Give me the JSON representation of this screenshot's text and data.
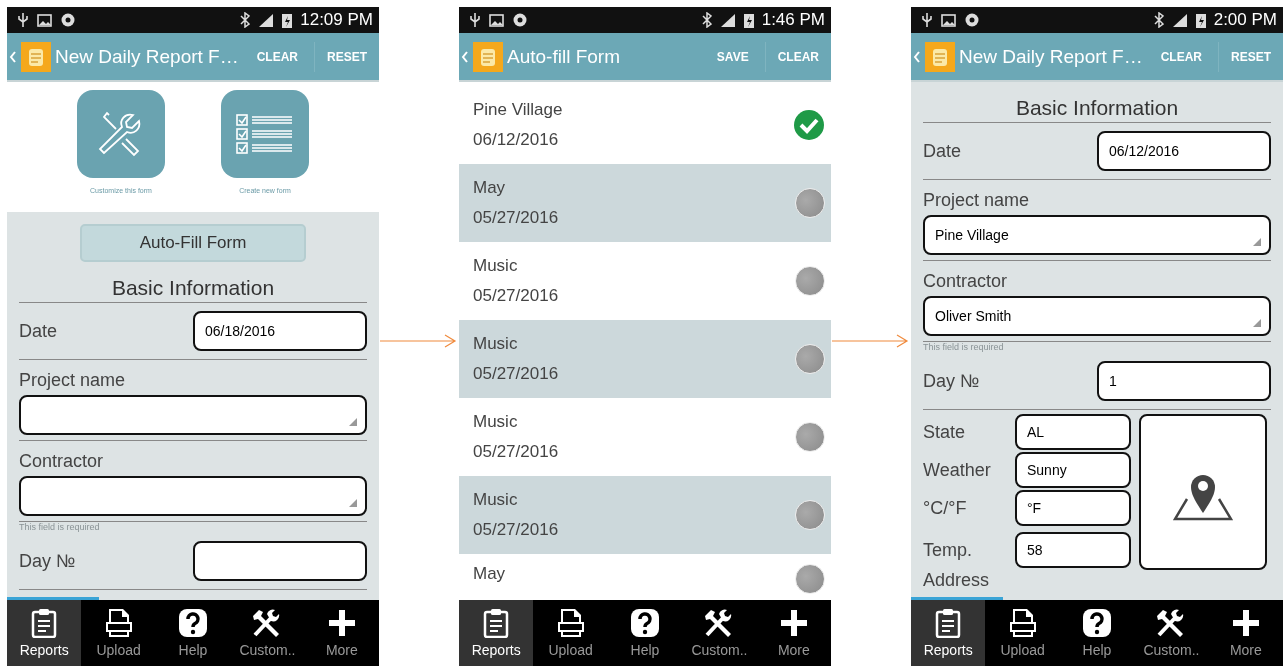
{
  "screens": [
    {
      "kind": "form",
      "status_bar": {
        "time": "12:09 PM"
      },
      "app_bar": {
        "title": "New Daily Report F…",
        "actions": [
          "CLEAR",
          "RESET"
        ]
      },
      "shortcuts": [
        {
          "kind": "tools",
          "label": "Customize this form"
        },
        {
          "kind": "checklist",
          "label": "Create new form"
        }
      ],
      "autofill_button": "Auto-Fill Form",
      "section_title": "Basic Information",
      "fields": [
        {
          "kind": "inline",
          "label": "Date",
          "value": "06/18/2016"
        },
        {
          "kind": "dropdown",
          "label": "Project name"
        },
        {
          "kind": "dropdown",
          "label": "Contractor",
          "error": "This field is required"
        },
        {
          "kind": "inline",
          "label": "Day №"
        }
      ],
      "nav": [
        {
          "label": "Reports",
          "selected": true
        },
        {
          "label": "Upload",
          "selected": false
        },
        {
          "label": "Help",
          "selected": false
        },
        {
          "label": "Custom..",
          "selected": false
        },
        {
          "label": "More",
          "selected": false
        }
      ]
    },
    {
      "kind": "list",
      "status_bar": {
        "time": "1:46 PM"
      },
      "app_bar": {
        "title": "Auto-fill Form",
        "actions": [
          "SAVE",
          "CLEAR"
        ]
      },
      "items": [
        {
          "title": "Pine Village",
          "date": "06/12/2016",
          "selected": true
        },
        {
          "title": "May",
          "date": "05/27/2016",
          "selected": false
        },
        {
          "title": "Music",
          "date": "05/27/2016",
          "selected": false
        },
        {
          "title": "Music",
          "date": "05/27/2016",
          "selected": false
        },
        {
          "title": "Music",
          "date": "05/27/2016",
          "selected": false
        },
        {
          "title": "Music",
          "date": "05/27/2016",
          "selected": false
        },
        {
          "title": "May",
          "selected": false
        }
      ],
      "nav": [
        {
          "label": "Reports",
          "selected": true
        },
        {
          "label": "Upload",
          "selected": false
        },
        {
          "label": "Help",
          "selected": false
        },
        {
          "label": "Custom..",
          "selected": false
        },
        {
          "label": "More",
          "selected": false
        }
      ]
    },
    {
      "kind": "form",
      "status_bar": {
        "time": "2:00 PM"
      },
      "app_bar": {
        "title": "New Daily Report F…",
        "actions": [
          "CLEAR",
          "RESET"
        ]
      },
      "section_title": "Basic Information",
      "fields": [
        {
          "kind": "inline",
          "label": "Date",
          "value": "06/12/2016"
        },
        {
          "kind": "dropdown",
          "label": "Project name",
          "value": "Pine Village"
        },
        {
          "kind": "dropdown",
          "label": "Contractor",
          "value": "Oliver Smith",
          "error": "This field is required"
        },
        {
          "kind": "inline",
          "label": "Day №",
          "value": "1"
        }
      ],
      "location": {
        "fields": [
          {
            "label": "State",
            "value": "AL"
          },
          {
            "label": "Weather",
            "value": "Sunny"
          },
          {
            "label": "°C/°F",
            "value": "°F"
          },
          {
            "label": "Temp.",
            "value": "58"
          }
        ],
        "next_label": "Address"
      },
      "nav": [
        {
          "label": "Reports",
          "selected": true
        },
        {
          "label": "Upload",
          "selected": false
        },
        {
          "label": "Help",
          "selected": false
        },
        {
          "label": "Custom..",
          "selected": false
        },
        {
          "label": "More",
          "selected": false
        }
      ]
    }
  ]
}
